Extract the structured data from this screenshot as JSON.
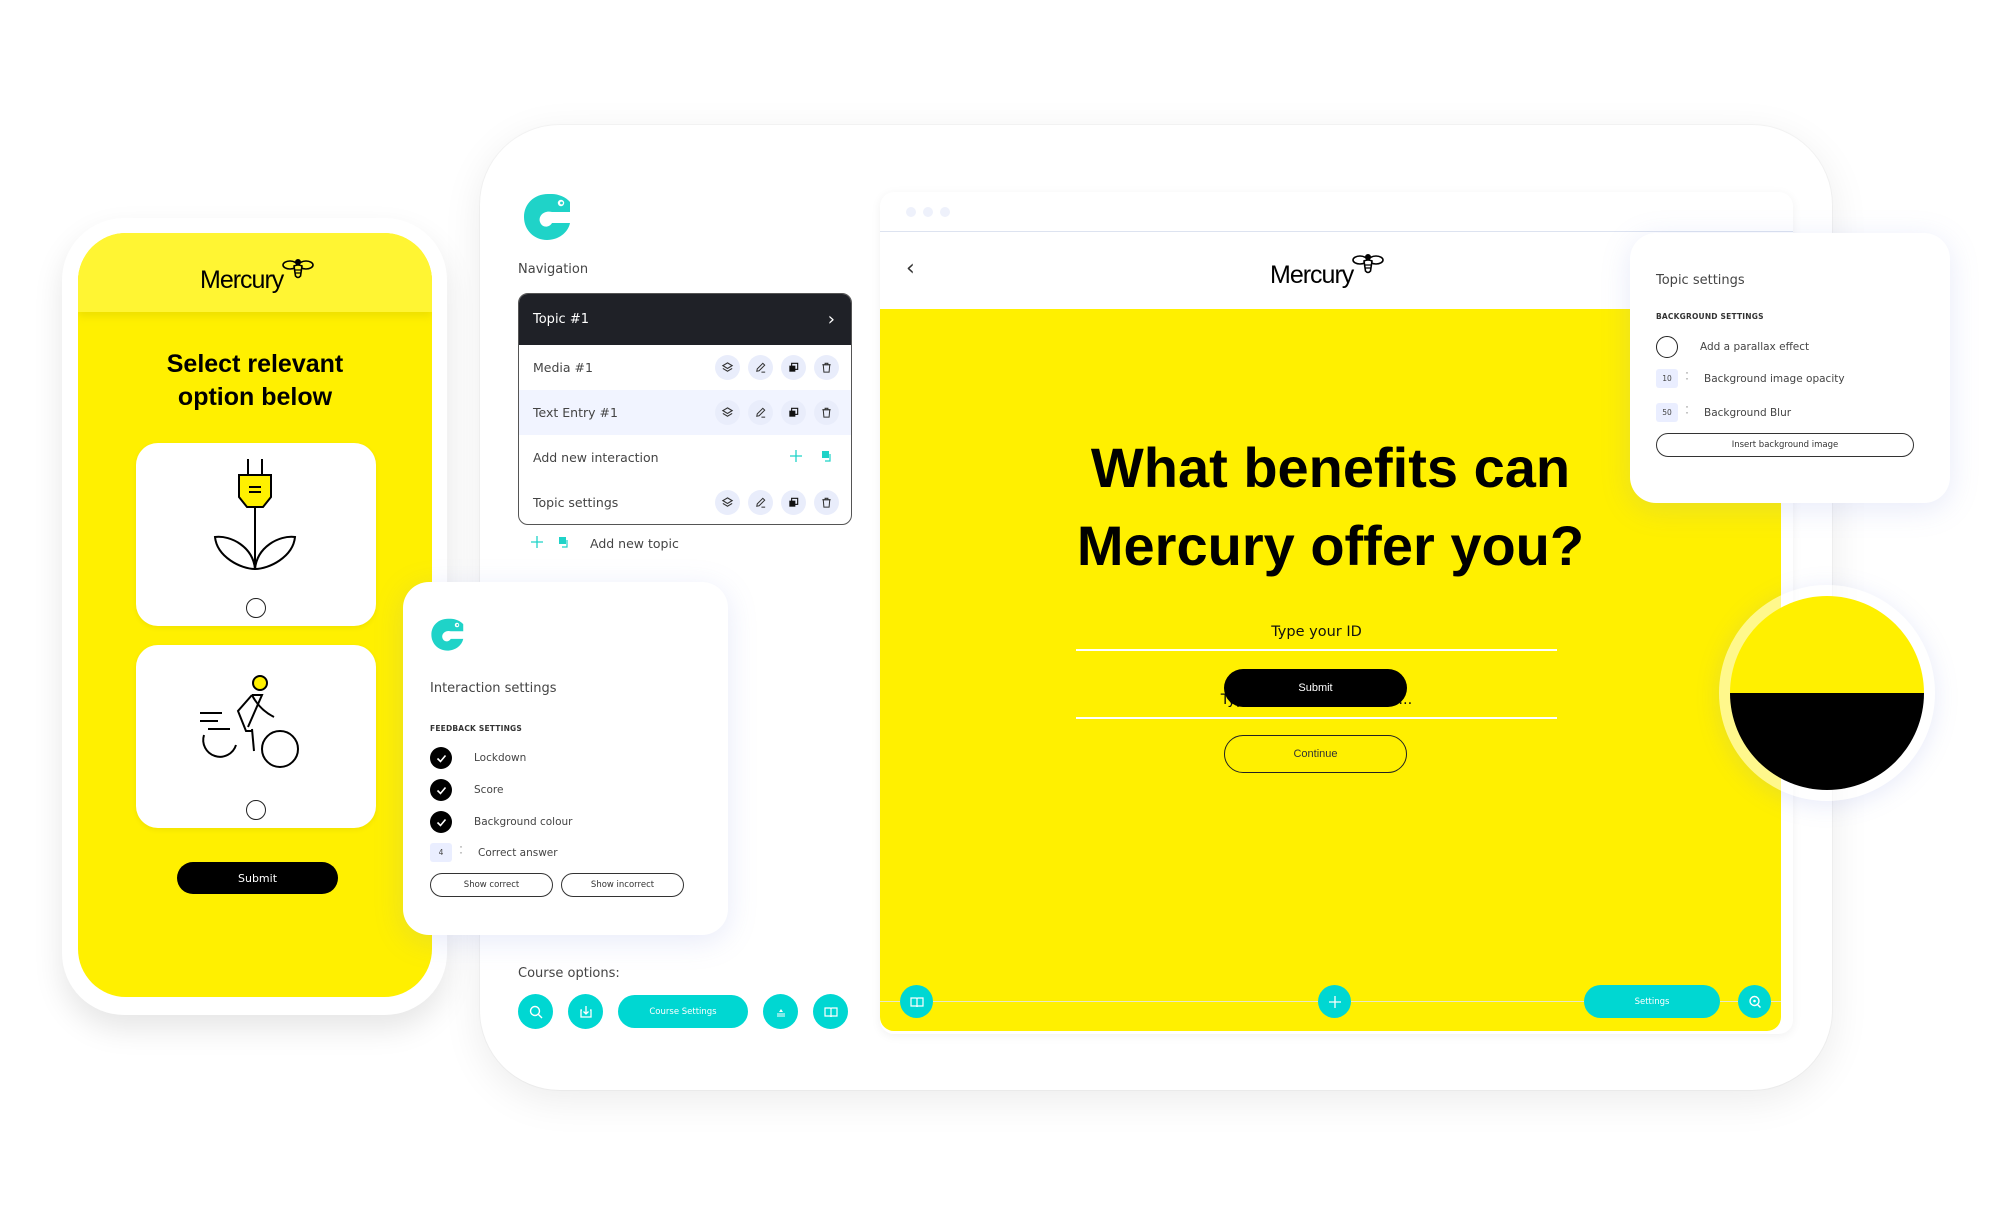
{
  "colors": {
    "brand_yellow": "#fff000",
    "teal": "#00d7d2",
    "dark": "#1f2127",
    "swatch_top": "#fff000",
    "swatch_bottom": "#000000"
  },
  "phone": {
    "brand": "Mercury",
    "title_line1": "Select relevant",
    "title_line2": "option below",
    "options": [
      {
        "icon": "plug-plant-icon",
        "selected": false
      },
      {
        "icon": "cyclist-icon",
        "selected": false
      }
    ],
    "submit_label": "Submit"
  },
  "navigation": {
    "title": "Navigation",
    "topic": {
      "label": "Topic #1",
      "icon": "chevron-right-icon"
    },
    "rows": [
      {
        "label": "Media #1",
        "actions": [
          "layers-icon",
          "edit-icon",
          "duplicate-icon",
          "trash-icon"
        ]
      },
      {
        "label": "Text Entry #1",
        "actions": [
          "layers-icon",
          "edit-icon",
          "duplicate-icon",
          "trash-icon"
        ]
      },
      {
        "label": "Add new interaction",
        "actions": [
          "plus-icon",
          "copy-icon"
        ]
      },
      {
        "label": "Topic settings",
        "actions": [
          "layers-icon",
          "edit-icon",
          "duplicate-icon",
          "trash-icon"
        ]
      }
    ],
    "add_topic_label": "Add new topic"
  },
  "interaction_settings": {
    "title": "Interaction settings",
    "section_label": "FEEDBACK SETTINGS",
    "checks": [
      {
        "label": "Lockdown",
        "checked": true
      },
      {
        "label": "Score",
        "checked": true
      },
      {
        "label": "Background colour",
        "checked": true
      }
    ],
    "correct_answer": {
      "value": "4",
      "label": "Correct answer"
    },
    "show_correct_label": "Show correct",
    "show_incorrect_label": "Show incorrect"
  },
  "course_options": {
    "label": "Course options:",
    "buttons": [
      {
        "icon": "search-icon"
      },
      {
        "icon": "download-icon"
      },
      {
        "label": "Course Settings"
      },
      {
        "icon": "eject-icon"
      },
      {
        "icon": "book-icon"
      }
    ]
  },
  "preview": {
    "brand": "Mercury",
    "back_icon": "chevron-left-icon",
    "headline_line1": "What benefits can",
    "headline_line2": "Mercury offer you?",
    "id_placeholder": "Type your ID",
    "message_placeholder": "Type your message here...",
    "submit_label": "Submit",
    "continue_label": "Continue",
    "toolbar": {
      "left_icon": "book-icon",
      "center_icon": "plus-icon",
      "settings_label": "Settings",
      "right_icon": "zoom-icon"
    }
  },
  "topic_settings": {
    "title": "Topic settings",
    "section_label": "BACKGROUND SETTINGS",
    "parallax_label": "Add a parallax effect",
    "parallax_enabled": false,
    "opacity": {
      "value": "10",
      "label": "Background image opacity"
    },
    "blur": {
      "value": "50",
      "label": "Background Blur"
    },
    "insert_label": "Insert background image"
  }
}
